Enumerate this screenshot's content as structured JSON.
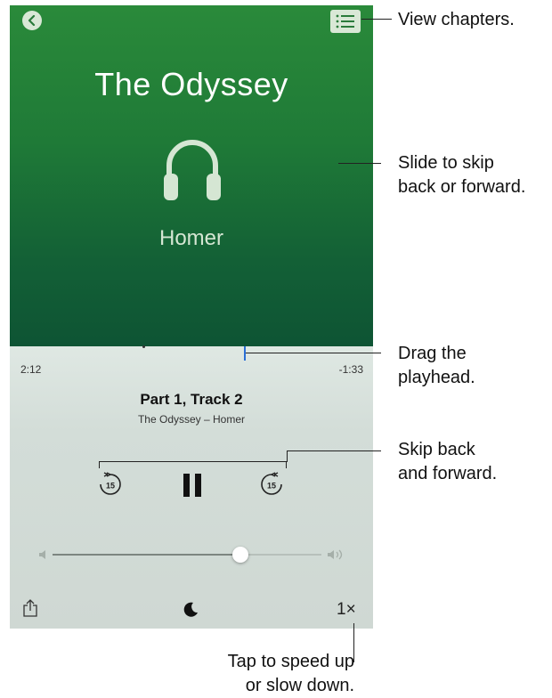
{
  "player": {
    "title": "The Odyssey",
    "author": "Homer",
    "elapsed": "2:12",
    "remaining": "-1:33",
    "track_title": "Part 1, Track 2",
    "track_subtitle": "The Odyssey – Homer",
    "skip_seconds": "15",
    "speed": "1×",
    "volume_percent": 70
  },
  "icons": {
    "back": "chevron-left-icon",
    "chapters": "list-icon",
    "artwork": "headphones-icon",
    "skip_back": "skip-back-15-icon",
    "pause": "pause-icon",
    "skip_forward": "skip-forward-15-icon",
    "volume_low": "speaker-low-icon",
    "volume_high": "speaker-high-icon",
    "share": "share-icon",
    "sleep": "moon-icon"
  },
  "colors": {
    "artwork_top": "#2a8a3a",
    "artwork_bottom": "#0e5434",
    "controls_bg": "#d3ddd8",
    "playhead": "#2a6fd6"
  },
  "callouts": {
    "view_chapters": "View chapters.",
    "slide_line1": "Slide to skip",
    "slide_line2": "back or forward.",
    "drag_line1": "Drag the",
    "drag_line2": "playhead.",
    "skip_line1": "Skip back",
    "skip_line2": "and forward.",
    "speed_line1": "Tap to speed up",
    "speed_line2": "or slow down."
  }
}
